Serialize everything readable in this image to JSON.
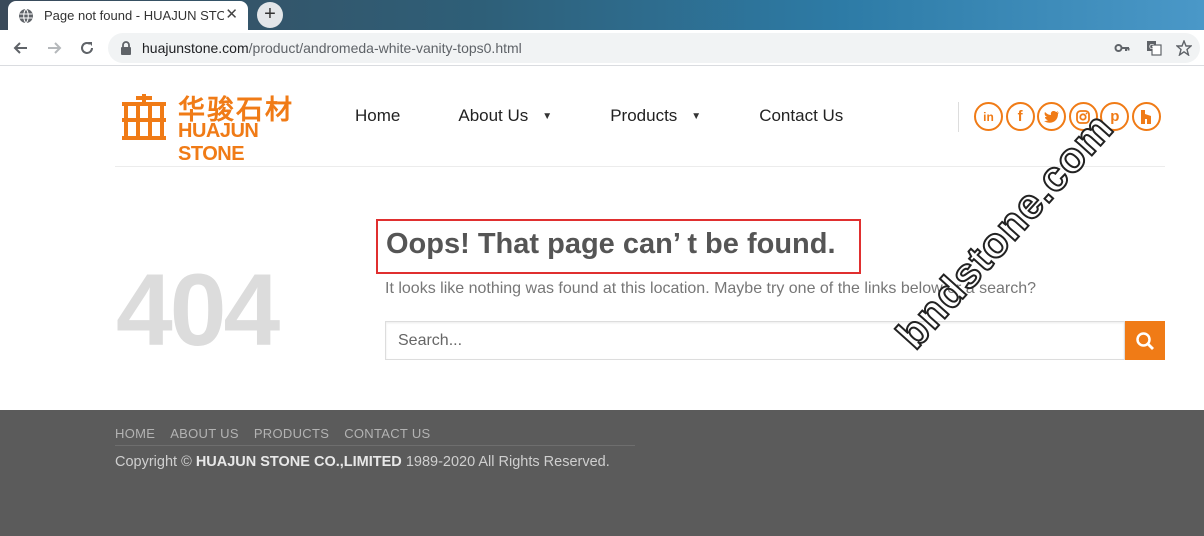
{
  "browser": {
    "tab_title": "Page not found - HUAJUN STONE",
    "tab_close": "✕",
    "new_tab": "+",
    "url_domain": "huajunstone.com",
    "url_path": "/product/andromeda-white-vanity-tops0.html"
  },
  "logo": {
    "chinese": "华骏石材",
    "english": "HUAJUN STONE"
  },
  "nav": {
    "items": [
      {
        "label": "Home",
        "dropdown": false
      },
      {
        "label": "About Us",
        "dropdown": true
      },
      {
        "label": "Products",
        "dropdown": true
      },
      {
        "label": "Contact Us",
        "dropdown": false
      }
    ]
  },
  "socials": [
    "linkedin-icon",
    "facebook-icon",
    "twitter-icon",
    "instagram-icon",
    "pinterest-icon",
    "houzz-icon"
  ],
  "error": {
    "code": "404",
    "heading": "Oops! That page can’ t be found.",
    "message": "It looks like nothing was found at this location. Maybe try one of the links below or a search?",
    "search_placeholder": "Search..."
  },
  "footer": {
    "links": [
      "HOME",
      "ABOUT US",
      "PRODUCTS",
      "CONTACT US"
    ],
    "copyright_prefix": "Copyright ©",
    "company": "HUAJUN STONE CO.,LIMITED",
    "copyright_suffix": "1989-2020 All Rights Reserved."
  },
  "watermark": "bndstone.com",
  "colors": {
    "accent": "#f07b16",
    "highlight_border": "#e02f2f",
    "footer_bg": "#5b5b5b"
  }
}
